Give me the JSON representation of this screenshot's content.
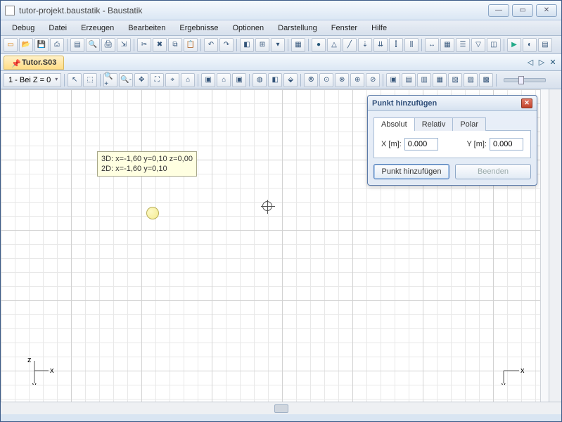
{
  "window": {
    "title": "tutor-projekt.baustatik - Baustatik"
  },
  "menu": [
    "Debug",
    "Datei",
    "Erzeugen",
    "Bearbeiten",
    "Ergebnisse",
    "Optionen",
    "Darstellung",
    "Fenster",
    "Hilfe"
  ],
  "tab": {
    "label": "Tutor.S03"
  },
  "viewbar": {
    "dropdown": "1 - Bei Z = 0"
  },
  "tooltip": {
    "line1": "3D: x=-1,60 y=0,10 z=0,00",
    "line2": "2D: x=-1,60 y=0,10"
  },
  "axes": {
    "x": "x",
    "y": "y",
    "z": "z"
  },
  "dialog": {
    "title": "Punkt hinzufügen",
    "tabs": {
      "absolut": "Absolut",
      "relativ": "Relativ",
      "polar": "Polar"
    },
    "xlabel": "X [m]:",
    "xval": "0.000",
    "ylabel": "Y [m]:",
    "yval": "0.000",
    "addBtn": "Punkt hinzufügen",
    "endBtn": "Beenden"
  }
}
